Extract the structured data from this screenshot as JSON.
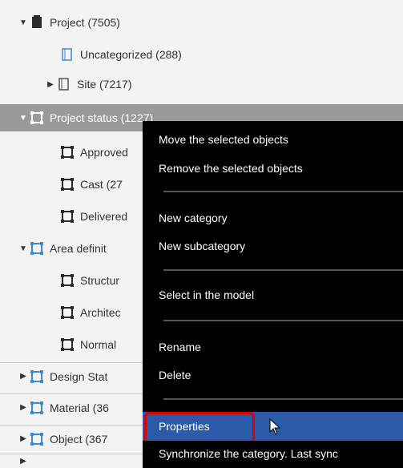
{
  "tree": [
    {
      "label": "Project (7505)",
      "arrow": "▼",
      "icon": "project-folder-icon"
    },
    {
      "label": "Uncategorized (288)",
      "arrow": "",
      "icon": "uncategorized-icon"
    },
    {
      "label": "Site (7217)",
      "arrow": "▶",
      "icon": "site-icon"
    },
    {
      "label": "Project status (1227)",
      "arrow": "▼",
      "icon": "category-icon"
    },
    {
      "label": "Approved",
      "arrow": "",
      "icon": "category-icon"
    },
    {
      "label": "Cast (27",
      "arrow": "",
      "icon": "category-icon"
    },
    {
      "label": "Delivered",
      "arrow": "",
      "icon": "category-icon"
    },
    {
      "label": "Area definit",
      "arrow": "▼",
      "icon": "category-icon"
    },
    {
      "label": "Structur",
      "arrow": "",
      "icon": "category-icon"
    },
    {
      "label": "Architec",
      "arrow": "",
      "icon": "category-icon"
    },
    {
      "label": "Normal",
      "arrow": "",
      "icon": "category-icon"
    },
    {
      "label": "Design Stat",
      "arrow": "▶",
      "icon": "category-icon"
    },
    {
      "label": "Material (36",
      "arrow": "▶",
      "icon": "category-icon"
    },
    {
      "label": "Object (367",
      "arrow": "▶",
      "icon": "category-icon"
    }
  ],
  "menu": {
    "move": "Move the selected objects",
    "remove": "Remove the selected objects",
    "new_category": "New category",
    "new_subcategory": "New subcategory",
    "select_in_model": "Select in the model",
    "rename": "Rename",
    "delete": "Delete",
    "properties": "Properties",
    "synchronize": "Synchronize the category. Last sync"
  },
  "colors": {
    "menu_bg": "#000000",
    "menu_highlight": "#2a5aa8",
    "callout": "#dd0000",
    "selected_row": "#9a9a9a",
    "icon_dark": "#2a2a2a",
    "icon_blue": "#3a8ad6"
  }
}
